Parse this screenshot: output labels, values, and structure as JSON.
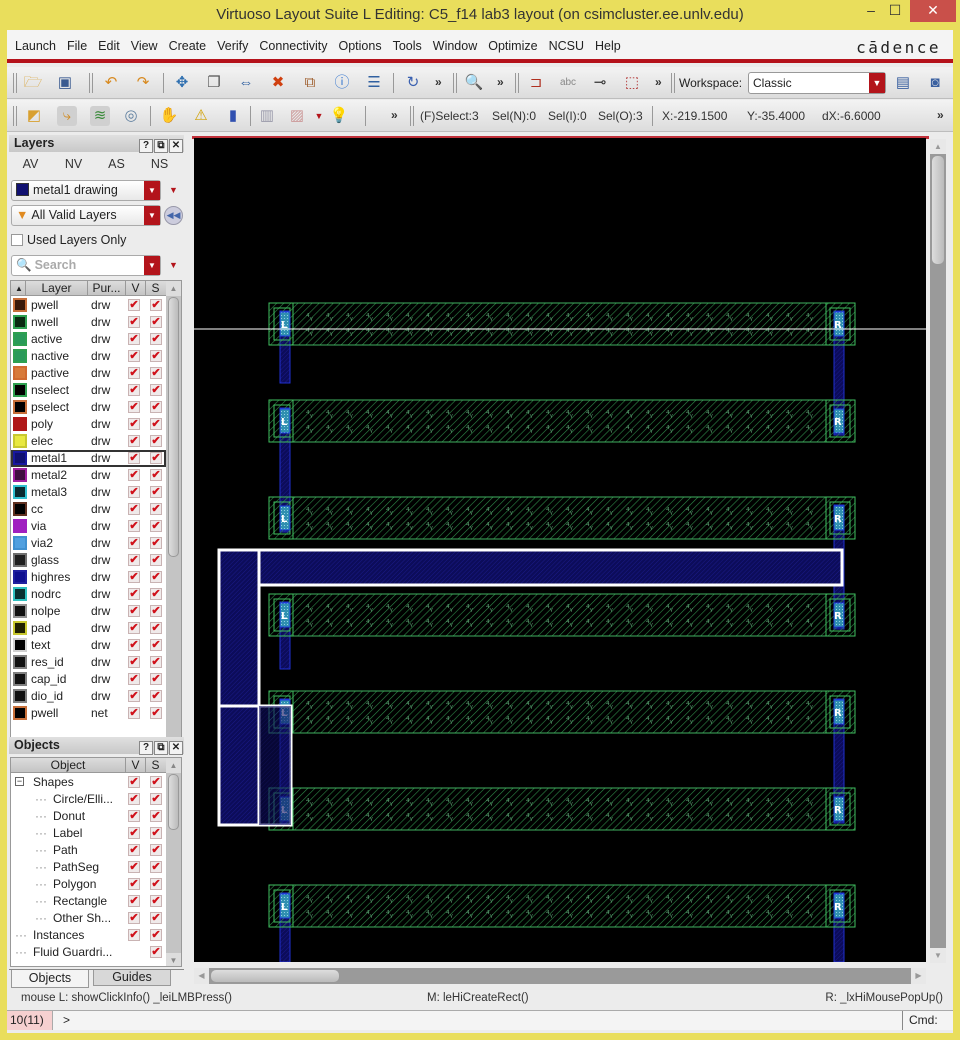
{
  "window": {
    "title": "Virtuoso Layout Suite L Editing: C5_f14 lab3 layout (on csimcluster.ee.unlv.edu)",
    "minimize": "–",
    "maximize": "☐",
    "close": "✕"
  },
  "menubar": {
    "items": [
      "Launch",
      "File",
      "Edit",
      "View",
      "Create",
      "Verify",
      "Connectivity",
      "Options",
      "Tools",
      "Window",
      "Optimize",
      "NCSU",
      "Help"
    ],
    "logo": "cādence"
  },
  "toolbar1": {
    "icons": [
      "open-folder-icon",
      "save-icon",
      "undo-icon",
      "redo-icon",
      "move-icon",
      "copy-icon",
      "stretch-icon",
      "delete-icon",
      "properties-icon",
      "info-icon",
      "align-icon",
      "hierarchy-icon",
      "zoom-icon",
      "connectivity-icon",
      "label-icon",
      "pin-icon",
      "select-area-icon"
    ],
    "more": "»",
    "workspace_label": "Workspace:",
    "workspace_value": "Classic"
  },
  "toolbar2": {
    "more": "»",
    "status": {
      "select": "(F)Select:3",
      "sel_n": "Sel(N):0",
      "sel_i": "Sel(I):0",
      "sel_o": "Sel(O):3",
      "x": "X:-219.1500",
      "y": "Y:-35.4000",
      "dx": "dX:-6.6000"
    }
  },
  "layers_panel": {
    "title": "Layers",
    "tabs": [
      "AV",
      "NV",
      "AS",
      "NS"
    ],
    "current_layer": "metal1 drawing",
    "filter": "All Valid Layers",
    "used_layers_only": "Used Layers Only",
    "search_placeholder": "Search",
    "columns": [
      "Layer",
      "Pur...",
      "V",
      "S"
    ],
    "rows": [
      {
        "name": "pwell",
        "purpose": "drw",
        "color": "#c8703a",
        "fill": "#3a1a0a"
      },
      {
        "name": "nwell",
        "purpose": "drw",
        "color": "#2ea050",
        "fill": "#0a2a12"
      },
      {
        "name": "active",
        "purpose": "drw",
        "color": "#2ea050",
        "fill": "#2a9a5a"
      },
      {
        "name": "nactive",
        "purpose": "drw",
        "color": "#2ea050",
        "fill": "#2a9a5a"
      },
      {
        "name": "pactive",
        "purpose": "drw",
        "color": "#d06a30",
        "fill": "#d87a3a"
      },
      {
        "name": "nselect",
        "purpose": "drw",
        "color": "#2ea050",
        "fill": "#000000"
      },
      {
        "name": "pselect",
        "purpose": "drw",
        "color": "#c8703a",
        "fill": "#000000"
      },
      {
        "name": "poly",
        "purpose": "drw",
        "color": "#b01818",
        "fill": "#b01818"
      },
      {
        "name": "elec",
        "purpose": "drw",
        "color": "#c8c830",
        "fill": "#e8e840"
      },
      {
        "name": "metal1",
        "purpose": "drw",
        "color": "#1818a0",
        "fill": "#101070"
      },
      {
        "name": "metal2",
        "purpose": "drw",
        "color": "#a020a0",
        "fill": "#401040"
      },
      {
        "name": "metal3",
        "purpose": "drw",
        "color": "#30c0d0",
        "fill": "#0a2a30"
      },
      {
        "name": "cc",
        "purpose": "drw",
        "color": "#603020",
        "fill": "#000000"
      },
      {
        "name": "via",
        "purpose": "drw",
        "color": "#a020c0",
        "fill": "#a020c0"
      },
      {
        "name": "via2",
        "purpose": "drw",
        "color": "#4090d0",
        "fill": "#50a0e0"
      },
      {
        "name": "glass",
        "purpose": "drw",
        "color": "#707070",
        "fill": "#202020"
      },
      {
        "name": "highres",
        "purpose": "drw",
        "color": "#2020a0",
        "fill": "#101090"
      },
      {
        "name": "nodrc",
        "purpose": "drw",
        "color": "#30c0c0",
        "fill": "#0a3030"
      },
      {
        "name": "nolpe",
        "purpose": "drw",
        "color": "#909090",
        "fill": "#101010"
      },
      {
        "name": "pad",
        "purpose": "drw",
        "color": "#c8c830",
        "fill": "#202000"
      },
      {
        "name": "text",
        "purpose": "drw",
        "color": "#d0d0d0",
        "fill": "#000000"
      },
      {
        "name": "res_id",
        "purpose": "drw",
        "color": "#808080",
        "fill": "#101010"
      },
      {
        "name": "cap_id",
        "purpose": "drw",
        "color": "#808080",
        "fill": "#101010"
      },
      {
        "name": "dio_id",
        "purpose": "drw",
        "color": "#808080",
        "fill": "#101010"
      },
      {
        "name": "pwell",
        "purpose": "net",
        "color": "#c8703a",
        "fill": "#000000"
      }
    ],
    "selected_row": 9
  },
  "objects_panel": {
    "title": "Objects",
    "columns": [
      "Object",
      "V",
      "S"
    ],
    "rows": [
      {
        "name": "Shapes",
        "level": 0,
        "v": true,
        "s": true
      },
      {
        "name": "Circle/Elli...",
        "level": 1,
        "v": true,
        "s": true
      },
      {
        "name": "Donut",
        "level": 1,
        "v": true,
        "s": true
      },
      {
        "name": "Label",
        "level": 1,
        "v": true,
        "s": true
      },
      {
        "name": "Path",
        "level": 1,
        "v": true,
        "s": true
      },
      {
        "name": "PathSeg",
        "level": 1,
        "v": true,
        "s": true
      },
      {
        "name": "Polygon",
        "level": 1,
        "v": true,
        "s": true
      },
      {
        "name": "Rectangle",
        "level": 1,
        "v": true,
        "s": true
      },
      {
        "name": "Other Sh...",
        "level": 1,
        "v": true,
        "s": true
      },
      {
        "name": "Instances",
        "level": 0,
        "v": true,
        "s": true
      },
      {
        "name": "Fluid Guardri...",
        "level": 0,
        "v": false,
        "s": true
      }
    ],
    "bottom_tabs": [
      "Objects",
      "Guides"
    ]
  },
  "mouse_status": {
    "left": "mouse L: showClickInfo() _leiLMBPress()",
    "middle": "M: leHiCreateRect()",
    "right": "R: _lxHiMousePopUp()"
  },
  "command_line": {
    "counter": "10(11)",
    "prompt": ">",
    "cmd_label": "Cmd:"
  },
  "layout": {
    "resistor_rows": 7,
    "left_contact_label": "L",
    "right_contact_label": "R"
  }
}
